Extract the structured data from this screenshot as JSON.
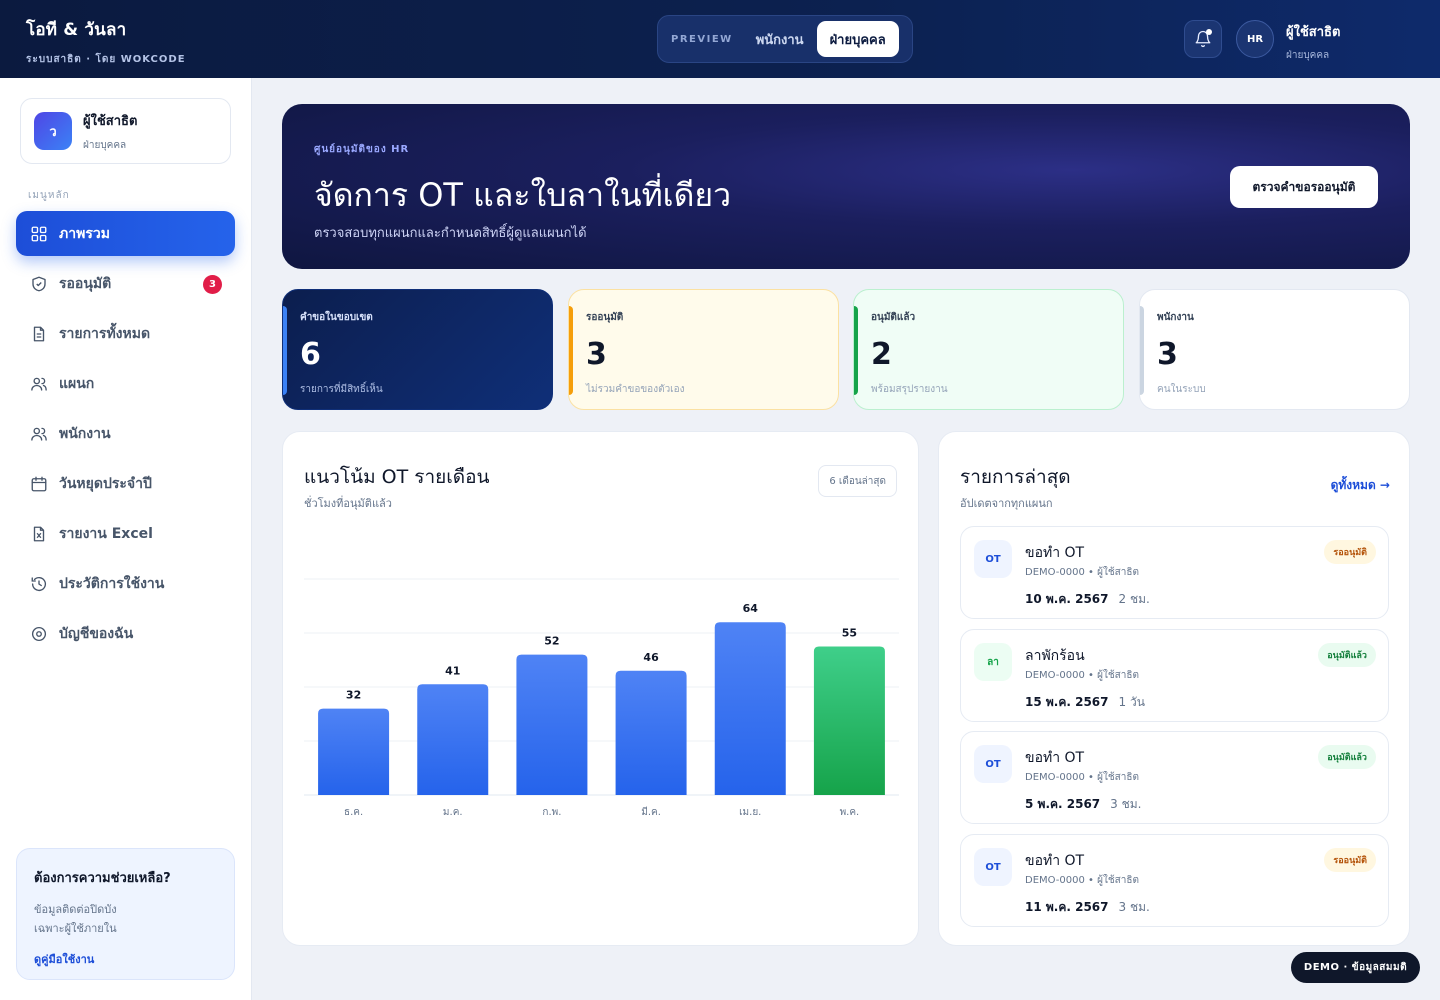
{
  "app": {
    "title": "โอที & วันลา",
    "subtitle": "ระบบสาธิต · โดย WOKCODE"
  },
  "topnav": {
    "preview": "PREVIEW",
    "tabs": [
      "พนักงาน",
      "ฝ่ายบุคคล"
    ],
    "active_tab": "ฝ่ายบุคคล"
  },
  "user": {
    "initials": "HR",
    "name": "ผู้ใช้สาธิต",
    "role": "ฝ่ายบุคคล",
    "avatar_letter": "ว"
  },
  "sidebar": {
    "menu_label": "เมนูหลัก",
    "items": [
      {
        "label": "ภาพรวม",
        "icon": "grid-icon",
        "active": true
      },
      {
        "label": "รออนุมัติ",
        "icon": "shield-check-icon",
        "badge": "3"
      },
      {
        "label": "รายการทั้งหมด",
        "icon": "document-icon"
      },
      {
        "label": "แผนก",
        "icon": "users-icon"
      },
      {
        "label": "พนักงาน",
        "icon": "users-icon"
      },
      {
        "label": "วันหยุดประจำปี",
        "icon": "calendar-icon"
      },
      {
        "label": "รายงาน Excel",
        "icon": "excel-file-icon"
      },
      {
        "label": "ประวัติการใช้งาน",
        "icon": "history-icon"
      },
      {
        "label": "บัญชีของฉัน",
        "icon": "settings-icon"
      }
    ],
    "help": {
      "title": "ต้องการความช่วยเหลือ?",
      "desc": "ข้อมูลติดต่อปิดบังเฉพาะผู้ใช้ภายใน",
      "link": "ดูคู่มือใช้งาน"
    }
  },
  "hero": {
    "kicker": "ศูนย์อนุมัติของ HR",
    "title": "จัดการ OT และใบลาในที่เดียว",
    "subtitle": "ตรวจสอบทุกแผนกและกำหนดสิทธิ์ผู้ดูแลแผนกได้",
    "button": "ตรวจคำขอรออนุมัติ"
  },
  "stats": [
    {
      "label": "คำขอในขอบเขต",
      "value": "6",
      "sub": "รายการที่มีสิทธิ์เห็น"
    },
    {
      "label": "รออนุมัติ",
      "value": "3",
      "sub": "ไม่รวมคำขอของตัวเอง"
    },
    {
      "label": "อนุมัติแล้ว",
      "value": "2",
      "sub": "พร้อมสรุปรายงาน"
    },
    {
      "label": "พนักงาน",
      "value": "3",
      "sub": "คนในระบบ"
    }
  ],
  "chart": {
    "title": "แนวโน้ม OT รายเดือน",
    "subtitle": "ชั่วโมงที่อนุมัติแล้ว",
    "range": "6 เดือนล่าสุด"
  },
  "chart_data": {
    "type": "bar",
    "categories": [
      "ธ.ค.",
      "ม.ค.",
      "ก.พ.",
      "มี.ค.",
      "เม.ย.",
      "พ.ค."
    ],
    "values": [
      32,
      41,
      52,
      46,
      64,
      55
    ],
    "highlight_last": true,
    "ylim": [
      0,
      80
    ],
    "colors": {
      "bar": "#2563eb",
      "bar_light": "#4f83f5",
      "highlight": "#16a34a",
      "highlight_light": "#3fcf8a"
    },
    "grid": true
  },
  "recent": {
    "title": "รายการล่าสุด",
    "subtitle": "อัปเดตจากทุกแผนก",
    "see_all": "ดูทั้งหมด →",
    "items": [
      {
        "tag": "OT",
        "type": "ot",
        "title": "ขอทำ OT",
        "meta": "DEMO-0000 • ผู้ใช้สาธิต",
        "date": "10 พ.ค. 2567",
        "amount": "2 ชม.",
        "status": "รออนุมัติ",
        "status_type": "pending"
      },
      {
        "tag": "ลา",
        "type": "leave",
        "title": "ลาพักร้อน",
        "meta": "DEMO-0000 • ผู้ใช้สาธิต",
        "date": "15 พ.ค. 2567",
        "amount": "1 วัน",
        "status": "อนุมัติแล้ว",
        "status_type": "approved"
      },
      {
        "tag": "OT",
        "type": "ot",
        "title": "ขอทำ OT",
        "meta": "DEMO-0000 • ผู้ใช้สาธิต",
        "date": "5 พ.ค. 2567",
        "amount": "3 ชม.",
        "status": "อนุมัติแล้ว",
        "status_type": "approved"
      },
      {
        "tag": "OT",
        "type": "ot",
        "title": "ขอทำ OT",
        "meta": "DEMO-0000 • ผู้ใช้สาธิต",
        "date": "11 พ.ค. 2567",
        "amount": "3 ชม.",
        "status": "รออนุมัติ",
        "status_type": "pending"
      }
    ]
  },
  "demo_badge": "DEMO · ข้อมูลสมมติ"
}
